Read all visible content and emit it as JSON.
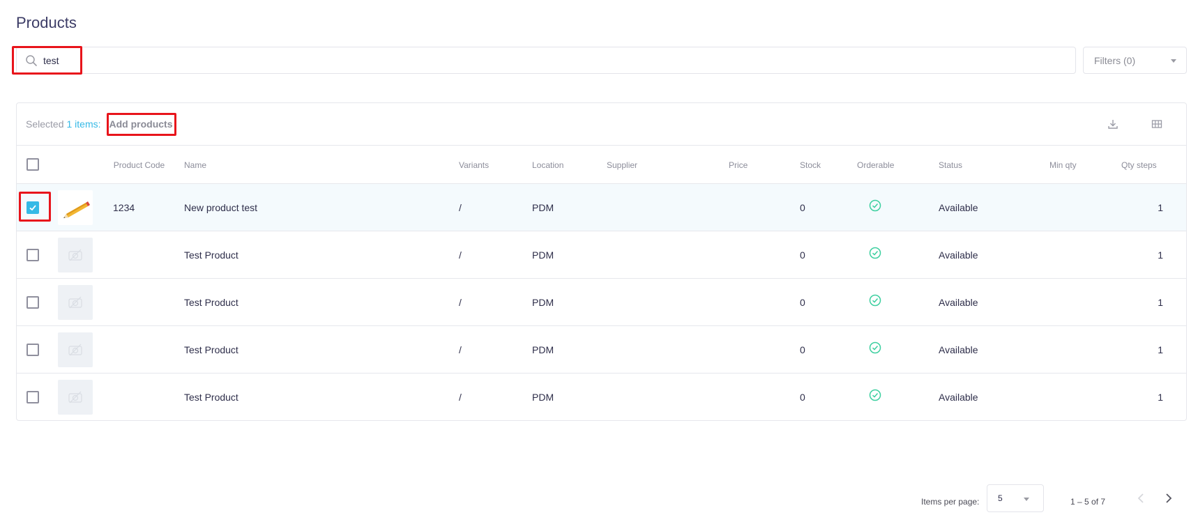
{
  "page": {
    "title": "Products"
  },
  "search": {
    "value": "test",
    "placeholder": ""
  },
  "filters": {
    "label": "Filters (0)"
  },
  "toolbar": {
    "selected_prefix": "Selected",
    "selected_count": "1 items:",
    "add_products_label": "Add products",
    "icons": [
      "download-icon",
      "grid-columns-icon"
    ]
  },
  "table": {
    "columns": {
      "select": "",
      "image": "",
      "product_code": "Product Code",
      "name": "Name",
      "variants": "Variants",
      "location": "Location",
      "supplier": "Supplier",
      "price": "Price",
      "stock": "Stock",
      "orderable": "Orderable",
      "status": "Status",
      "min_qty": "Min qty",
      "qty_steps": "Qty steps"
    },
    "rows": [
      {
        "selected": true,
        "image": "pencil-image",
        "product_code": "1234",
        "name": "New product test",
        "variants": "/",
        "location": "PDM",
        "supplier": "",
        "price": "",
        "stock": "0",
        "orderable": true,
        "status": "Available",
        "min_qty": "",
        "qty_steps": "1"
      },
      {
        "selected": false,
        "image": "placeholder-image",
        "product_code": "",
        "name": "Test Product",
        "variants": "/",
        "location": "PDM",
        "supplier": "",
        "price": "",
        "stock": "0",
        "orderable": true,
        "status": "Available",
        "min_qty": "",
        "qty_steps": "1"
      },
      {
        "selected": false,
        "image": "placeholder-image",
        "product_code": "",
        "name": "Test Product",
        "variants": "/",
        "location": "PDM",
        "supplier": "",
        "price": "",
        "stock": "0",
        "orderable": true,
        "status": "Available",
        "min_qty": "",
        "qty_steps": "1"
      },
      {
        "selected": false,
        "image": "placeholder-image",
        "product_code": "",
        "name": "Test Product",
        "variants": "/",
        "location": "PDM",
        "supplier": "",
        "price": "",
        "stock": "0",
        "orderable": true,
        "status": "Available",
        "min_qty": "",
        "qty_steps": "1"
      },
      {
        "selected": false,
        "image": "placeholder-image",
        "product_code": "",
        "name": "Test Product",
        "variants": "/",
        "location": "PDM",
        "supplier": "",
        "price": "",
        "stock": "0",
        "orderable": true,
        "status": "Available",
        "min_qty": "",
        "qty_steps": "1"
      }
    ]
  },
  "pagination": {
    "items_per_page_label": "Items per page:",
    "items_per_page_value": "5",
    "range_label": "1 – 5 of 7",
    "prev_enabled": false,
    "next_enabled": true
  },
  "colors": {
    "accent": "#35b9e6",
    "orderable_check": "#3ccf9f",
    "highlight": "#e8141b"
  }
}
